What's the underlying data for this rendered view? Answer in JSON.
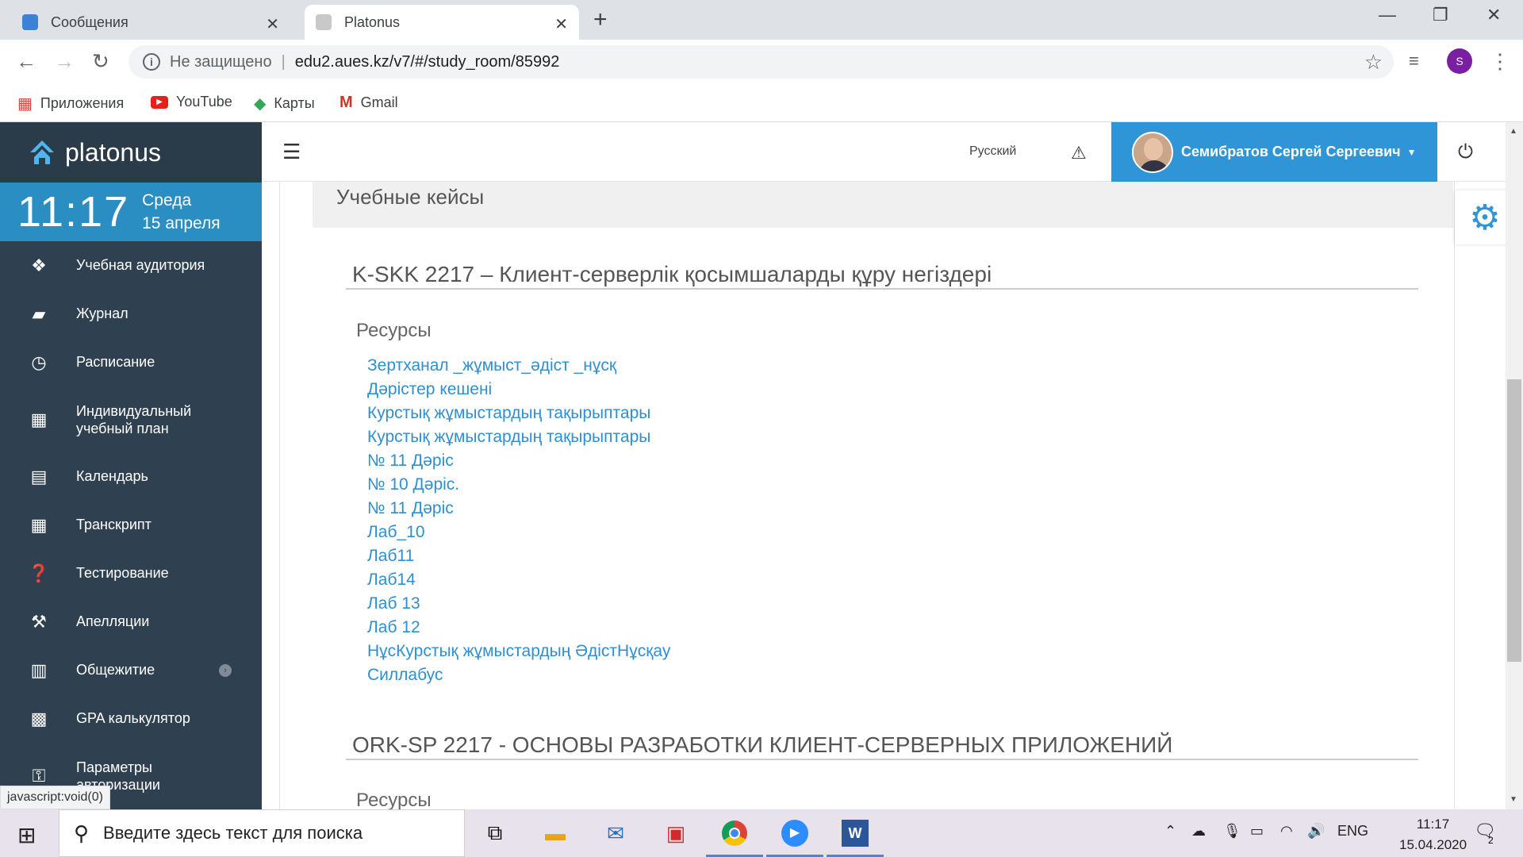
{
  "browser": {
    "tabs": [
      {
        "title": "Сообщения",
        "active": false
      },
      {
        "title": "Platonus",
        "active": true
      }
    ],
    "omnibox": {
      "security": "Не защищено",
      "url": "edu2.aues.kz/v7/#/study_room/85992"
    },
    "profile_initial": "S",
    "bookmarks": [
      {
        "label": "Приложения",
        "icon": "apps-grid-icon"
      },
      {
        "label": "YouTube",
        "icon": "youtube-icon"
      },
      {
        "label": "Карты",
        "icon": "maps-icon"
      },
      {
        "label": "Gmail",
        "icon": "gmail-icon"
      }
    ],
    "status_url": "javascript:void(0)"
  },
  "app": {
    "brand": "platonus",
    "clock": {
      "time": "11:17",
      "weekday": "Среда",
      "date": "15 апреля"
    },
    "nav": [
      {
        "label": "Учебная аудитория",
        "icon": "cubes-icon"
      },
      {
        "label": "Журнал",
        "icon": "book-icon"
      },
      {
        "label": "Расписание",
        "icon": "clock-icon"
      },
      {
        "label": "Индивидуальный учебный план",
        "icon": "grid-icon"
      },
      {
        "label": "Календарь",
        "icon": "calendar-icon"
      },
      {
        "label": "Транскрипт",
        "icon": "table-icon"
      },
      {
        "label": "Тестирование",
        "icon": "question-icon"
      },
      {
        "label": "Апелляции",
        "icon": "gavel-icon"
      },
      {
        "label": "Общежитие",
        "icon": "building-icon"
      },
      {
        "label": "GPA калькулятор",
        "icon": "calculator-icon"
      },
      {
        "label": "Параметры авторизации",
        "icon": "key-icon"
      }
    ],
    "header": {
      "language": "Русский",
      "user_name": "Семибратов Сергей Сергеевич"
    },
    "section_title": "Учебные кейсы",
    "courses": [
      {
        "title": "K-SKK 2217 – Клиент-серверлік қосымшаларды құру негіздері",
        "resources_label": "Ресурсы",
        "resources": [
          "Зертханал _жұмыст_әдіст _нұсқ",
          "Дәрістер кешені",
          "Курстық жұмыстардың тақырыптары",
          "Курстық жұмыстардың тақырыптары",
          "№ 11 Дәріс",
          "№ 10 Дәріс.",
          "№ 11 Дәріс",
          "Лаб_10",
          "Лаб11",
          "Лаб14",
          "Лаб 13",
          "Лаб 12",
          "НұсКурстық жұмыстардың ӘдістНұсқау",
          "Силлабус"
        ]
      },
      {
        "title": "ORK-SP 2217 - ОСНОВЫ РАЗРАБОТКИ КЛИЕНТ-СЕРВЕРНЫХ ПРИЛОЖЕНИЙ",
        "resources_label": "Ресурсы",
        "resources": []
      }
    ],
    "colors": {
      "sidebar": "#2f4150",
      "accent": "#2f95d7",
      "link": "#2f8fd0"
    }
  },
  "taskbar": {
    "search_placeholder": "Введите здесь текст для поиска",
    "language": "ENG",
    "time": "11:17",
    "date": "15.04.2020",
    "notifications": "2"
  }
}
